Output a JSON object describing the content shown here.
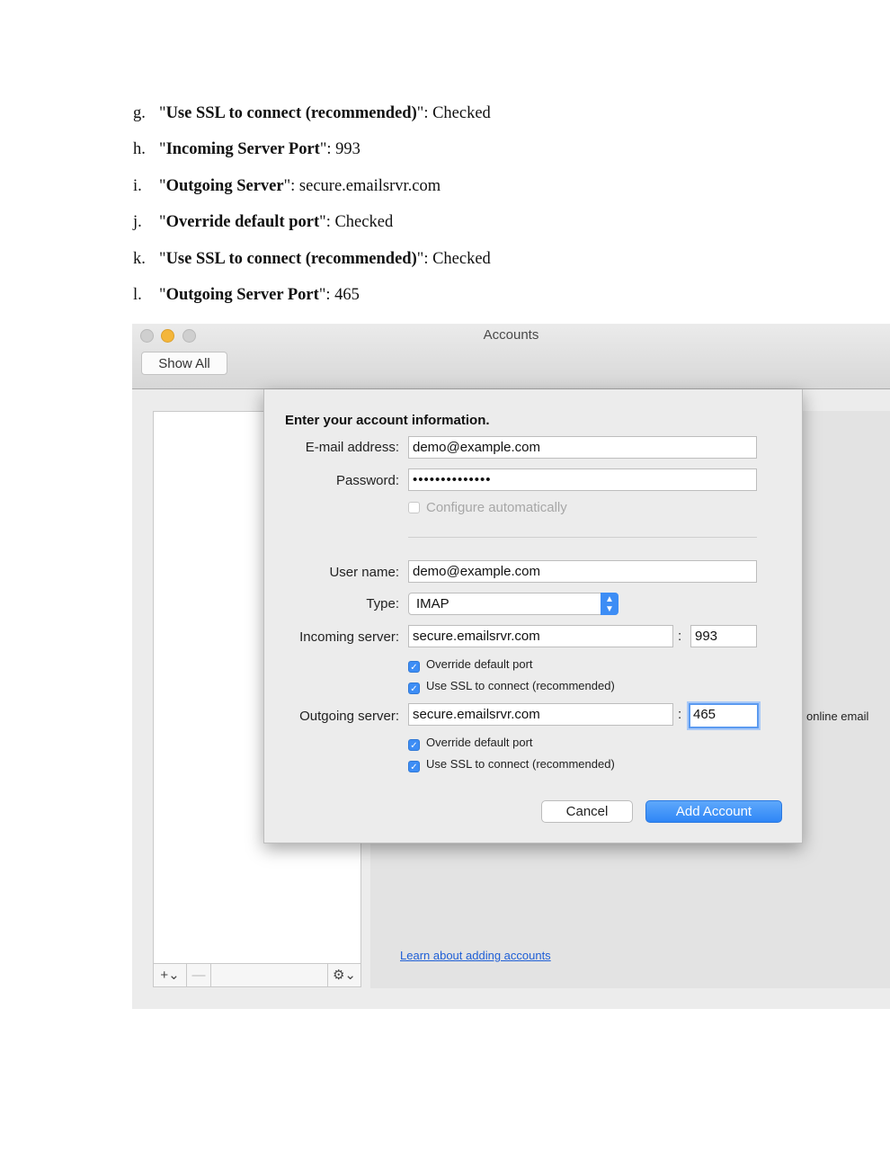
{
  "doc_items": [
    {
      "marker": "g.",
      "q1": "\"",
      "label": "Use SSL to connect (recommended)",
      "q2": "\"",
      "value": ": Checked"
    },
    {
      "marker": "h.",
      "q1": "\"",
      "label": "Incoming Server Port",
      "q2": "\"",
      "value": ": 993"
    },
    {
      "marker": "i.",
      "q1": "\"",
      "label": "Outgoing Server",
      "q2": "\"",
      "value": ": secure.emailsrvr.com"
    },
    {
      "marker": "j.",
      "q1": "\"",
      "label": "Override default port",
      "q2": "\"",
      "value": ": Checked"
    },
    {
      "marker": "k.",
      "q1": "\"",
      "label": "Use SSL to connect (recommended)",
      "q2": "\"",
      "value": ": Checked"
    },
    {
      "marker": "l.",
      "q1": "\"",
      "label": "Outgoing Server Port",
      "q2": "\"",
      "value": ": 465"
    }
  ],
  "window": {
    "title": "Accounts",
    "show_all": "Show All",
    "add_symbol": "+⌄",
    "remove_symbol": "—",
    "gear_symbol": "⚙⌄",
    "online_email_fragment": "online email",
    "learn_link": "Learn about adding accounts"
  },
  "dialog": {
    "heading": "Enter your account information.",
    "email_label": "E-mail address:",
    "email_value": "demo@example.com",
    "password_label": "Password:",
    "password_value": "••••••••••••••",
    "configure_auto": "Configure automatically",
    "configure_auto_checked": false,
    "username_label": "User name:",
    "username_value": "demo@example.com",
    "type_label": "Type:",
    "type_value": "IMAP",
    "incoming_label": "Incoming server:",
    "incoming_value": "secure.emailsrvr.com",
    "incoming_port": "993",
    "outgoing_label": "Outgoing server:",
    "outgoing_value": "secure.emailsrvr.com",
    "outgoing_port": "465",
    "colon": ":",
    "override_port": "Override default port",
    "use_ssl": "Use SSL to connect (recommended)",
    "cancel": "Cancel",
    "add_account": "Add Account"
  },
  "colors": {
    "accent": "#3d8df5",
    "link": "#1f5fd6",
    "minimize": "#f4b63a"
  }
}
